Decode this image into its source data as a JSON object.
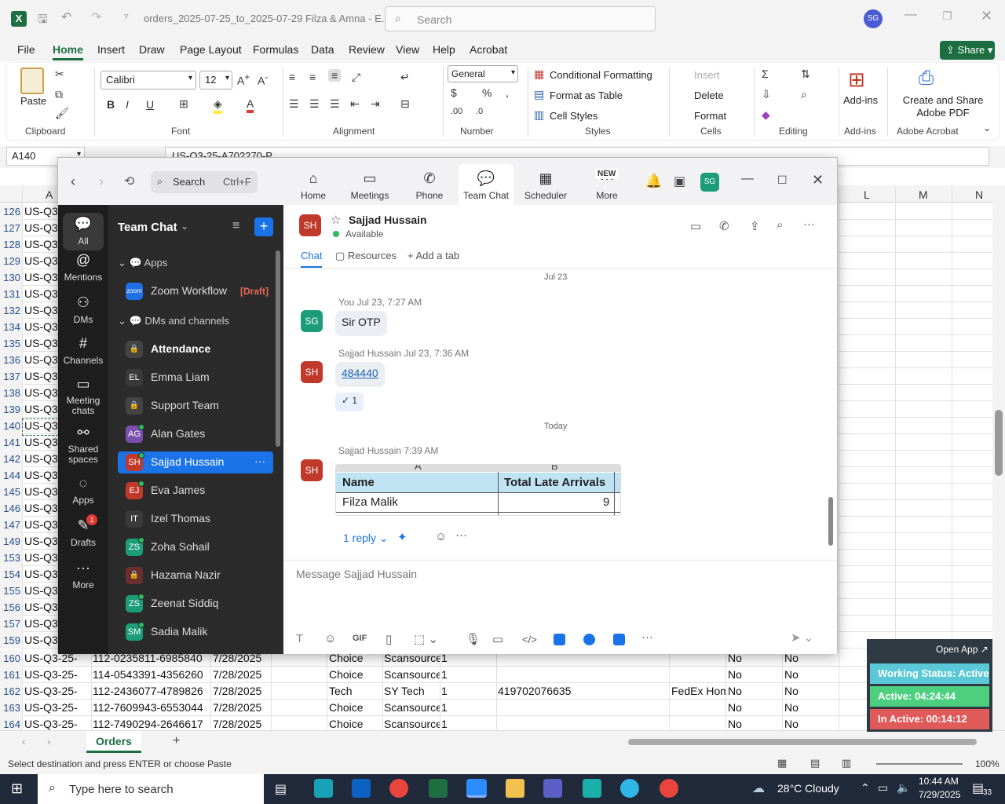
{
  "excel": {
    "title": "orders_2025-07-25_to_2025-07-29 Filza & Amna - E...",
    "search_placeholder": "Search",
    "user_initials": "SG",
    "share_label": "Share",
    "tabs": [
      "File",
      "Home",
      "Insert",
      "Draw",
      "Page Layout",
      "Formulas",
      "Data",
      "Review",
      "View",
      "Help",
      "Acrobat"
    ],
    "font_name": "Calibri",
    "font_size": "12",
    "number_format": "General",
    "groups": {
      "clipboard": "Clipboard",
      "font": "Font",
      "alignment": "Alignment",
      "number": "Number",
      "styles": "Styles",
      "cells": "Cells",
      "editing": "Editing",
      "addins": "Add-ins",
      "adobe": "Adobe Acrobat"
    },
    "paste_label": "Paste",
    "cond_format": "Conditional Formatting",
    "format_table": "Format as Table",
    "cell_styles": "Cell Styles",
    "insert_label": "Insert",
    "delete_label": "Delete",
    "format_label": "Format",
    "addins_label": "Add-ins",
    "adobe_label": "Create and Share Adobe PDF",
    "name_box": "A140",
    "formula": "US-Q3-25-A702270-P",
    "col_headers": [
      "A",
      "L",
      "M",
      "N"
    ],
    "visible_rows": [
      {
        "n": "126",
        "a": "US-Q3"
      },
      {
        "n": "127",
        "a": "US-Q3"
      },
      {
        "n": "128",
        "a": "US-Q3"
      },
      {
        "n": "129",
        "a": "US-Q3"
      },
      {
        "n": "130",
        "a": "US-Q3"
      },
      {
        "n": "131",
        "a": "US-Q3"
      },
      {
        "n": "132",
        "a": "US-Q3"
      },
      {
        "n": "134",
        "a": "US-Q3"
      },
      {
        "n": "135",
        "a": "US-Q3"
      },
      {
        "n": "136",
        "a": "US-Q3"
      },
      {
        "n": "137",
        "a": "US-Q3"
      },
      {
        "n": "138",
        "a": "US-Q3"
      },
      {
        "n": "139",
        "a": "US-Q3"
      },
      {
        "n": "140",
        "a": "US-Q3"
      },
      {
        "n": "141",
        "a": "US-Q3"
      },
      {
        "n": "142",
        "a": "US-Q3"
      },
      {
        "n": "144",
        "a": "US-Q3"
      },
      {
        "n": "145",
        "a": "US-Q3"
      },
      {
        "n": "146",
        "a": "US-Q3"
      },
      {
        "n": "147",
        "a": "US-Q3"
      },
      {
        "n": "149",
        "a": "US-Q3"
      },
      {
        "n": "153",
        "a": "US-Q3"
      },
      {
        "n": "154",
        "a": "US-Q3"
      },
      {
        "n": "155",
        "a": "US-Q3"
      },
      {
        "n": "156",
        "a": "US-Q3"
      },
      {
        "n": "157",
        "a": "US-Q3"
      },
      {
        "n": "159",
        "a": "US-Q3"
      }
    ],
    "bottom_rows": [
      {
        "n": "160",
        "a": "US-Q3-25-",
        "b": "112-0235811-6985840",
        "c": "7/28/2025",
        "e": "Choice",
        "f": "Scansource",
        "g": "1",
        "h": "",
        "i": "",
        "j": "No",
        "k": "No"
      },
      {
        "n": "161",
        "a": "US-Q3-25-",
        "b": "114-0543391-4356260",
        "c": "7/28/2025",
        "e": "Choice",
        "f": "Scansource",
        "g": "1",
        "h": "",
        "i": "",
        "j": "No",
        "k": "No"
      },
      {
        "n": "162",
        "a": "US-Q3-25-",
        "b": "112-2436077-4789826",
        "c": "7/28/2025",
        "e": "Tech",
        "f": "SY Tech",
        "g": "1",
        "h": "419702076635",
        "i": "FedEx Hom",
        "j": "No",
        "k": "No"
      },
      {
        "n": "163",
        "a": "US-Q3-25-",
        "b": "112-7609943-6553044",
        "c": "7/28/2025",
        "e": "Choice",
        "f": "Scansource",
        "g": "1",
        "h": "",
        "i": "",
        "j": "No",
        "k": "No"
      },
      {
        "n": "164",
        "a": "US-Q3-25-",
        "b": "112-7490294-2646617",
        "c": "7/28/2025",
        "e": "Choice",
        "f": "Scansource",
        "g": "1",
        "h": "",
        "i": "",
        "j": "No",
        "k": "No"
      }
    ],
    "sheet_tab": "Orders",
    "status_text": "Select destination and press ENTER or choose Paste",
    "zoom_level": "100%"
  },
  "zoom": {
    "search_label": "Search",
    "search_shortcut": "Ctrl+F",
    "nav_tabs": [
      {
        "label": "Home",
        "icon": "home-icon"
      },
      {
        "label": "Meetings",
        "icon": "video-icon"
      },
      {
        "label": "Phone",
        "icon": "phone-icon"
      },
      {
        "label": "Team Chat",
        "icon": "chat-icon"
      },
      {
        "label": "Scheduler",
        "icon": "calendar-icon"
      },
      {
        "label": "More",
        "icon": "more-icon"
      }
    ],
    "new_badge": "NEW",
    "user_initials": "SG",
    "rail": [
      {
        "label": "All"
      },
      {
        "label": "Mentions"
      },
      {
        "label": "DMs"
      },
      {
        "label": "Channels"
      },
      {
        "label": "Meeting chats"
      },
      {
        "label": "Shared spaces"
      },
      {
        "label": "Apps"
      },
      {
        "label": "Drafts",
        "badge": "1"
      },
      {
        "label": "More"
      }
    ],
    "list_title": "Team Chat",
    "sections": {
      "apps": "Apps",
      "dms": "DMs and channels"
    },
    "list": [
      {
        "initials": "zoom",
        "name": "Zoom Workflow",
        "tag": "[Draft]",
        "color": "#1f6fe5"
      },
      {
        "initials": "",
        "name": "Attendance",
        "color": "#444"
      },
      {
        "initials": "EL",
        "name": "Emma Liam",
        "color": "#3a3a3a"
      },
      {
        "initials": "",
        "name": "Support Team",
        "color": "#444"
      },
      {
        "initials": "AG",
        "name": "Alan Gates",
        "color": "#7a4fb0"
      },
      {
        "initials": "SH",
        "name": "Sajjad Hussain",
        "color": "#c0392b"
      },
      {
        "initials": "EJ",
        "name": "Eva James",
        "color": "#c0392b"
      },
      {
        "initials": "IT",
        "name": "Izel Thomas",
        "color": "#3a3a3a"
      },
      {
        "initials": "ZS",
        "name": "Zoha Sohail",
        "color": "#1b9e77"
      },
      {
        "initials": "",
        "name": "Hazama Nazir",
        "color": "#6b2f2f"
      },
      {
        "initials": "ZS",
        "name": "Zeenat Siddiq",
        "color": "#1b9e77"
      },
      {
        "initials": "SM",
        "name": "Sadia Malik",
        "color": "#1b9e77"
      }
    ],
    "chat": {
      "contact_initials": "SH",
      "contact_name": "Sajjad Hussain",
      "status": "Available",
      "tabs": [
        "Chat",
        "Resources",
        "Add a tab"
      ],
      "date1": "Jul 23",
      "msg1_meta": "You Jul 23, 7:27 AM",
      "msg1_text": "Sir OTP",
      "msg2_meta": "Sajjad Hussain Jul 23, 7:36 AM",
      "msg2_text": "484440",
      "reaction": "1",
      "date2": "Today",
      "msg3_meta": "Sajjad Hussain 7:39 AM",
      "table_cols": [
        "A",
        "B"
      ],
      "table_headers": [
        "Name",
        "Total Late Arrivals"
      ],
      "table_row": [
        "Filza Malik",
        "9"
      ],
      "reply_label": "1 reply",
      "composer_placeholder": "Message Sajjad Hussain"
    }
  },
  "status_panel": {
    "open_app": "Open App",
    "working": "Working Status: Active",
    "active": "Active: 04:24:44",
    "inactive": "In Active: 00:14:12",
    "colors": {
      "working": "#5bc8d8",
      "active": "#4cd080",
      "inactive": "#e05a5a"
    }
  },
  "taskbar": {
    "search_placeholder": "Type here to search",
    "weather": "28°C  Cloudy",
    "time": "10:44 AM",
    "date": "7/29/2025",
    "notifications": "33"
  }
}
